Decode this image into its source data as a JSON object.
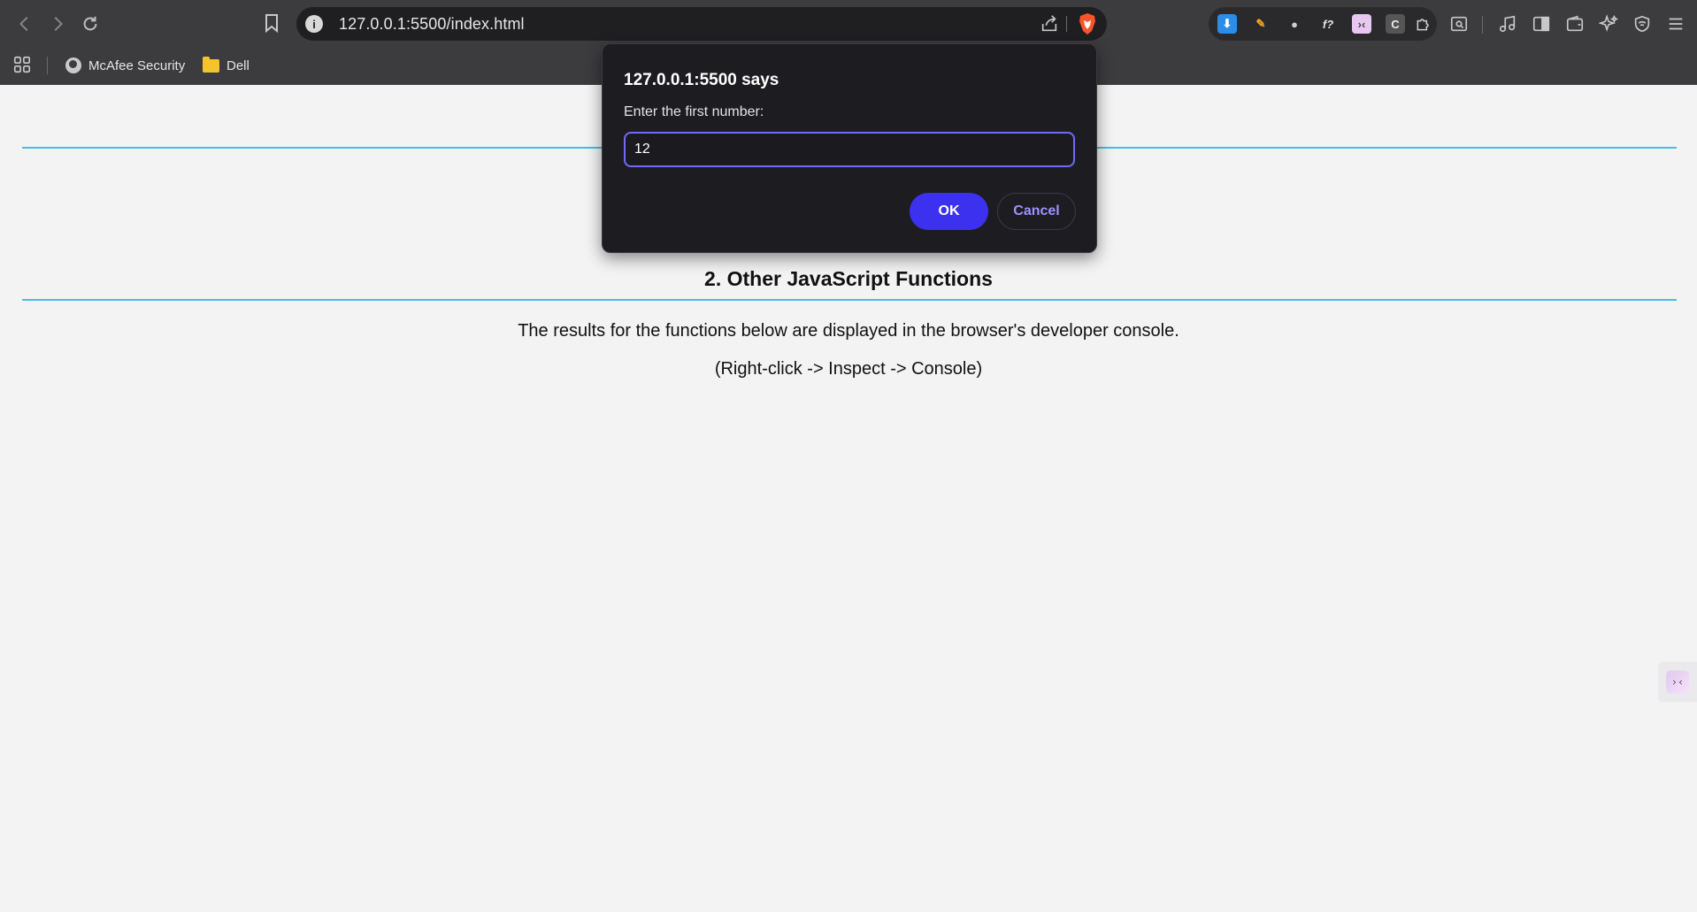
{
  "browser": {
    "url": "127.0.0.1:5500/index.html",
    "bookmarks": [
      {
        "label": "McAfee Security",
        "icon": "globe-icon"
      },
      {
        "label": "Dell",
        "icon": "folder-icon"
      }
    ],
    "accent_color": "#3d31f0"
  },
  "page": {
    "section_title": "2. Other JavaScript Functions",
    "intro": "The results for the functions below are displayed in the browser's developer console.",
    "hint": "(Right-click -> Inspect -> Console)",
    "rule_color": "#53b8dc"
  },
  "dialog": {
    "title": "127.0.0.1:5500 says",
    "message": "Enter the first number:",
    "input_value": "12",
    "ok_label": "OK",
    "cancel_label": "Cancel"
  }
}
